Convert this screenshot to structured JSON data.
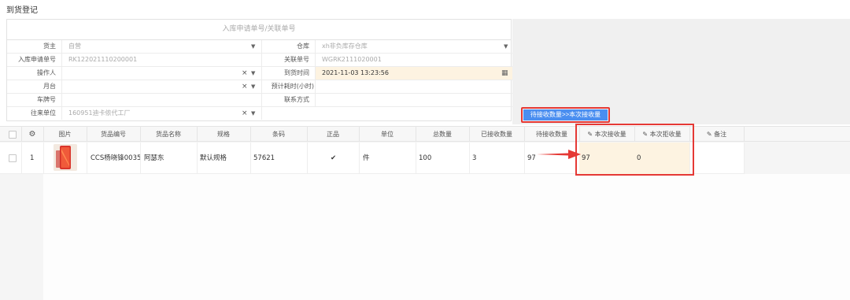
{
  "page": {
    "title": "到货登记"
  },
  "form": {
    "header_placeholder": "入库申请单号/关联单号",
    "rows": {
      "owner": {
        "label": "货主",
        "value": "自营"
      },
      "warehouse": {
        "label": "仓库",
        "value": "xh非负库存仓库"
      },
      "apply_no": {
        "label": "入库申请单号",
        "value": "RK122021110200001"
      },
      "rel_no": {
        "label": "关联单号",
        "value": "WGRK2111020001"
      },
      "operator": {
        "label": "操作人",
        "value": ""
      },
      "arrival_time": {
        "label": "到货时间",
        "value": "2021-11-03 13:23:56"
      },
      "platform": {
        "label": "月台",
        "value": ""
      },
      "est_hours": {
        "label": "预计耗时(小时)",
        "value": ""
      },
      "plate": {
        "label": "车牌号",
        "value": ""
      },
      "contact": {
        "label": "联系方式",
        "value": ""
      },
      "partner": {
        "label": "往来单位",
        "value": "160951迪卡侬代工厂"
      }
    }
  },
  "transfer_button": {
    "label": "待接收数量>>本次接收量"
  },
  "table": {
    "columns": {
      "image": "图片",
      "sku": "货品编号",
      "name": "货品名称",
      "spec": "规格",
      "barcode": "条码",
      "genuine": "正品",
      "unit": "单位",
      "total": "总数量",
      "received": "已接收数量",
      "pending": "待接收数量",
      "this_receive": "本次接收量",
      "this_reject": "本次拒收量",
      "remark": "备注"
    },
    "rows": [
      {
        "index": "1",
        "sku": "CCS杨晓锋0035",
        "name": "阿瑟东",
        "spec": "默认规格",
        "barcode": "57621",
        "genuine": "✔",
        "unit": "件",
        "total": "100",
        "received": "3",
        "pending": "97",
        "this_receive": "97",
        "this_reject": "0",
        "remark": ""
      }
    ]
  },
  "colors": {
    "accent": "#4a8ef0",
    "highlight": "#e53935",
    "edit_bg": "#fdf3e1"
  }
}
